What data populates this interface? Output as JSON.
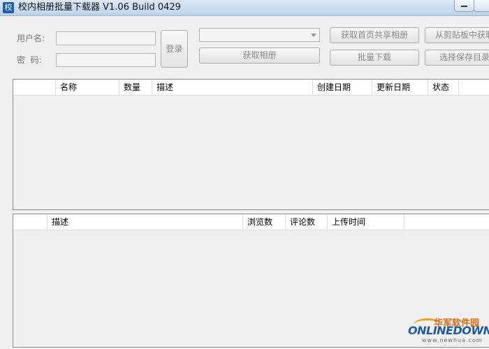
{
  "window": {
    "title": "校内相册批量下载器 V1.06 Build 0429",
    "icon_char": "校"
  },
  "login": {
    "username_label": "用户名:",
    "password_label": "密  码:",
    "username_value": "",
    "password_value": "",
    "login_button": "登录"
  },
  "toolbar": {
    "album_select_value": "",
    "fetch_albums": "获取相册",
    "fetch_homepage_shared": "获取首页共享相册",
    "batch_download": "批量下载",
    "from_clipboard": "从剪贴板中获取",
    "choose_save_dir": "选择保存目录"
  },
  "album_table": {
    "columns": [
      "",
      "名称",
      "数量",
      "描述",
      "创建日期",
      "更新日期",
      "状态"
    ]
  },
  "photo_table": {
    "columns": [
      "",
      "描述",
      "浏览数",
      "评论数",
      "上传时间"
    ]
  },
  "watermark": {
    "cn": "华军软件园",
    "en": "ONLINEDOWN",
    "url": "www.newhua.com"
  }
}
